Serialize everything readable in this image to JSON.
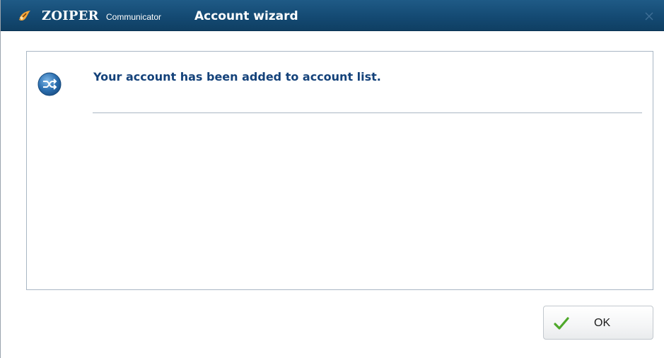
{
  "window": {
    "brand": "ZOIPER",
    "brand_sub": "Communicator",
    "title": "Account wizard",
    "close_icon": "close-icon",
    "logo_icon": "zoiper-logo-icon"
  },
  "content": {
    "status_icon": "shuffle-icon",
    "message": "Your account has been added to account list."
  },
  "footer": {
    "ok_label": "OK",
    "ok_icon": "checkmark-icon"
  },
  "colors": {
    "titlebar": "#144a73",
    "message_text": "#14427a",
    "check_green": "#4ea82a"
  }
}
